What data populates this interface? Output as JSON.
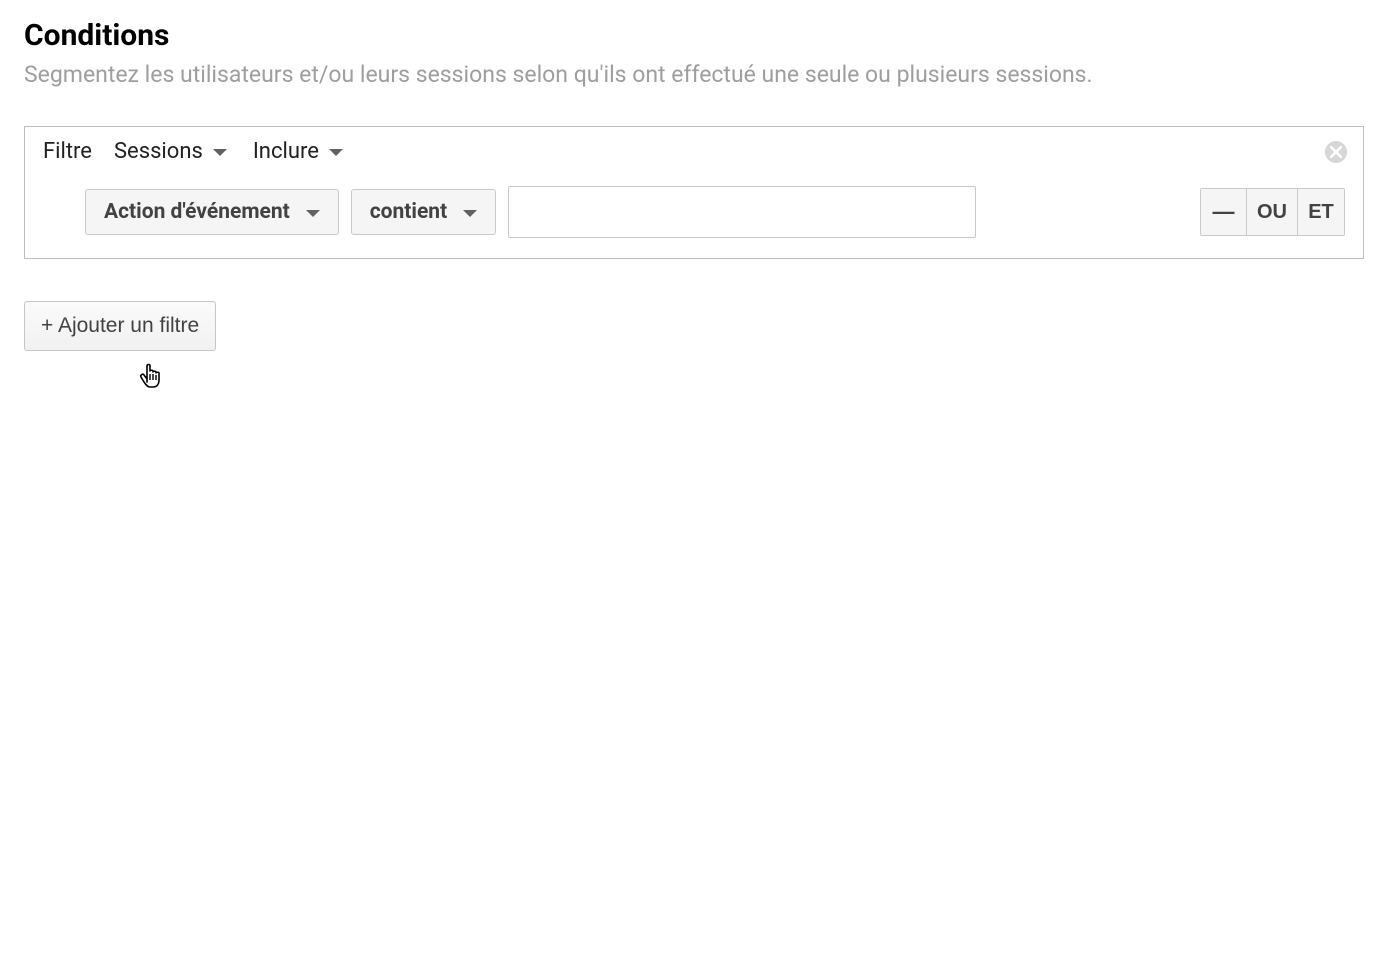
{
  "header": {
    "title": "Conditions",
    "subtitle": "Segmentez les utilisateurs et/ou leurs sessions selon qu'ils ont effectué une seule ou plusieurs sessions."
  },
  "filter": {
    "label": "Filtre",
    "scope": "Sessions",
    "mode": "Inclure",
    "dimension": "Action d'événement",
    "match": "contient",
    "value": "",
    "ops": {
      "minus": "—",
      "or": "OU",
      "and": "ET"
    }
  },
  "add_filter_label": "+ Ajouter un filtre"
}
